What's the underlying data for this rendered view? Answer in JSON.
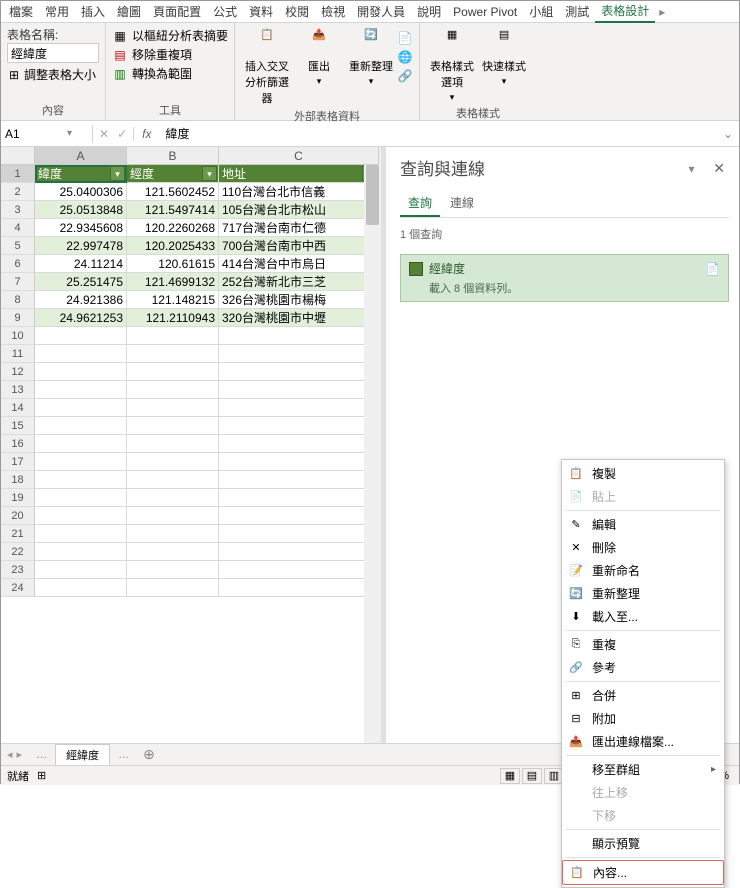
{
  "tabs": [
    "檔案",
    "常用",
    "插入",
    "繪圖",
    "頁面配置",
    "公式",
    "資料",
    "校閱",
    "檢視",
    "開發人員",
    "說明",
    "Power Pivot",
    "小組",
    "測試",
    "表格設計"
  ],
  "activeTab": "表格設計",
  "ribbon": {
    "group1": {
      "tblname_label": "表格名稱:",
      "tblname_value": "經緯度",
      "resize": "調整表格大小",
      "label": "內容"
    },
    "group2": {
      "pivot": "以樞紐分析表摘要",
      "dedup": "移除重複項",
      "range": "轉換為範圍",
      "label": "工具"
    },
    "group3": {
      "slicer": "插入交叉分析篩選器",
      "export": "匯出",
      "refresh": "重新整理",
      "label": "外部表格資料"
    },
    "group4": {
      "styleopt": "表格樣式選項",
      "quickstyle": "快速樣式",
      "label": "表格樣式"
    }
  },
  "nameBox": "A1",
  "formula": "緯度",
  "columns": [
    "A",
    "B",
    "C"
  ],
  "headerRow": [
    "緯度",
    "經度",
    "地址"
  ],
  "rows": [
    [
      "25.0400306",
      "121.5602452",
      "110台灣台北市信義"
    ],
    [
      "25.0513848",
      "121.5497414",
      "105台灣台北市松山"
    ],
    [
      "22.9345608",
      "120.2260268",
      "717台灣台南市仁德"
    ],
    [
      "22.997478",
      "120.2025433",
      "700台灣台南市中西"
    ],
    [
      "24.11214",
      "120.61615",
      "414台灣台中市烏日"
    ],
    [
      "25.251475",
      "121.4699132",
      "252台灣新北市三芝"
    ],
    [
      "24.921386",
      "121.148215",
      "326台灣桃園市楊梅"
    ],
    [
      "24.9621253",
      "121.2110943",
      "320台灣桃園市中壢"
    ]
  ],
  "sheetTab": "經緯度",
  "statusText": "就緒",
  "queryPane": {
    "title": "查詢與連線",
    "tab1": "查詢",
    "tab2": "連線",
    "count": "1 個查詢",
    "item_name": "經緯度",
    "item_desc": "載入 8 個資料列。"
  },
  "contextMenu": {
    "copy": "複製",
    "paste": "貼上",
    "edit": "編輯",
    "delete": "刪除",
    "rename": "重新命名",
    "refresh": "重新整理",
    "loadto": "載入至...",
    "duplicate": "重複",
    "reference": "參考",
    "merge": "合併",
    "append": "附加",
    "exportconn": "匯出連線檔案...",
    "movegroup": "移至群組",
    "moveup": "往上移",
    "movedown": "下移",
    "showpreview": "顯示預覽",
    "properties": "內容..."
  },
  "zoom": "100%"
}
